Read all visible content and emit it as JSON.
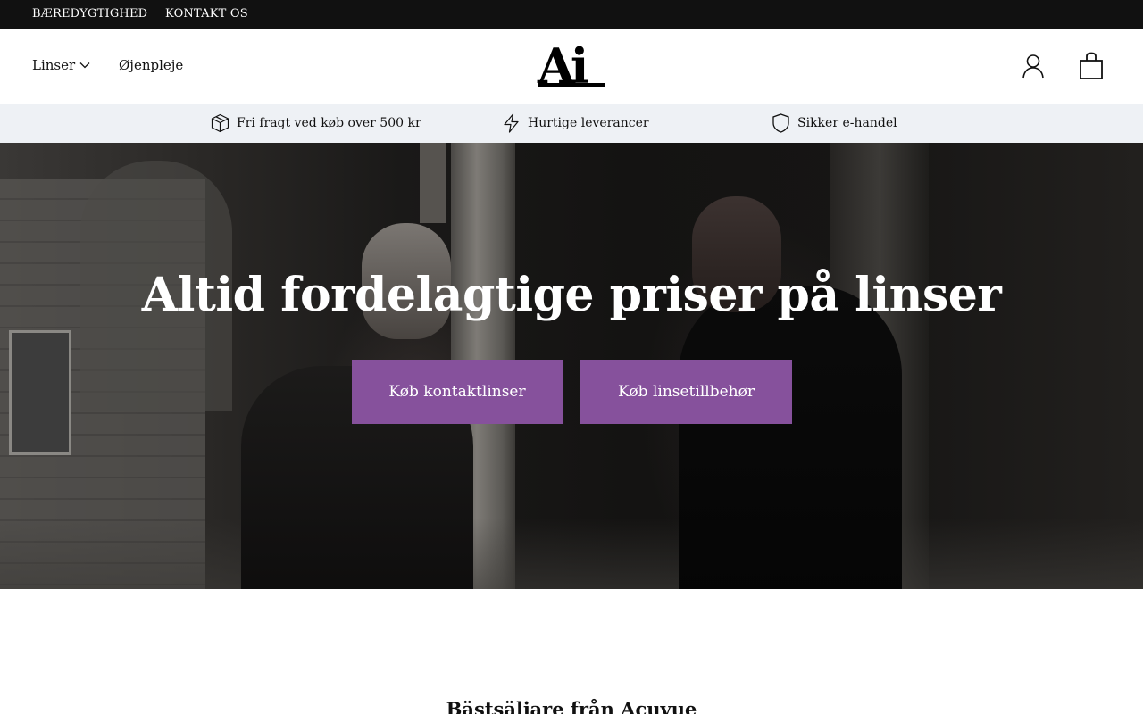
{
  "topbar": {
    "links": [
      "BÆREDYGTIGHED",
      "KONTAKT OS"
    ]
  },
  "header": {
    "nav": {
      "linser": "Linser",
      "ojenpleje": "Øjenpleje"
    },
    "logo_text": "Ai",
    "icons": [
      "chevron-down-icon",
      "user-icon",
      "shopping-bag-icon"
    ]
  },
  "usp": {
    "items": [
      "Fri fragt ved køb over 500 kr",
      "Hurtige leverancer",
      "Sikker e-handel"
    ],
    "icons": [
      "package-icon",
      "lightning-icon",
      "shield-icon"
    ]
  },
  "hero": {
    "title": "Altid fordelagtige priser på linser",
    "buttons": [
      "Køb kontaktlinser",
      "Køb linsetillbehør"
    ],
    "button_color": "#86519c"
  },
  "bestsellers": {
    "title": "Bästsäljare från Acuvue"
  },
  "colors": {
    "topbar_bg": "#111111",
    "usp_bg": "#eef1f5",
    "accent": "#86519c"
  }
}
